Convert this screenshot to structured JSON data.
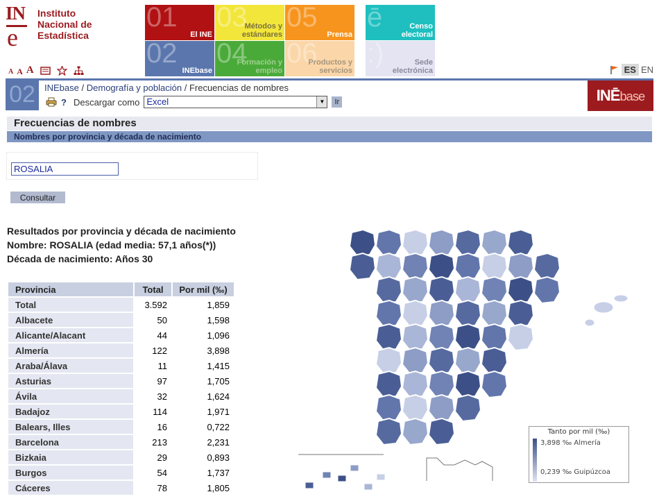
{
  "header": {
    "logo_lines": [
      "Instituto",
      "Nacional de",
      "Estadística"
    ],
    "tiles": [
      {
        "num": "01",
        "label": "El INE"
      },
      {
        "num": "03",
        "label": "Métodos y estándares"
      },
      {
        "num": "05",
        "label": "Prensa"
      },
      {
        "num": "ē",
        "label": "Censo electoral"
      },
      {
        "num": "02",
        "label": "INEbase"
      },
      {
        "num": "04",
        "label": "Formación y empleo"
      },
      {
        "num": "06",
        "label": "Productos y servicios"
      },
      {
        "num": ":)",
        "label": "Sede electrónica"
      }
    ],
    "font_sizes": [
      "A",
      "A",
      "A"
    ],
    "lang": {
      "active": "ES",
      "other": "EN"
    }
  },
  "breadcrumb": {
    "badge": "02",
    "items": [
      "INEbase",
      "Demografía y población",
      "Frecuencias de nombres"
    ],
    "separator": "/",
    "help": "?",
    "download_label": "Descargar como",
    "download_value": "Excel",
    "go_label": "Ir",
    "inebase_brand_a": "INĒ",
    "inebase_brand_b": "base"
  },
  "page": {
    "title": "Frecuencias de nombres",
    "subtitle": "Nombres por provincia y década de nacimiento",
    "search_value": "ROSALIA",
    "consultar_label": "Consultar",
    "results_heading": "Resultados por provincia y década de nacimiento",
    "results_name": "Nombre: ROSALIA (edad media: 57,1 años(*))",
    "results_decade": "Década de nacimiento: Años 30"
  },
  "table": {
    "headers": [
      "Provincia",
      "Total",
      "Por mil (‰)"
    ],
    "rows": [
      [
        "Total",
        "3.592",
        "1,859"
      ],
      [
        "Albacete",
        "50",
        "1,598"
      ],
      [
        "Alicante/Alacant",
        "44",
        "1,096"
      ],
      [
        "Almería",
        "122",
        "3,898"
      ],
      [
        "Araba/Álava",
        "11",
        "1,415"
      ],
      [
        "Asturias",
        "97",
        "1,705"
      ],
      [
        "Ávila",
        "32",
        "1,624"
      ],
      [
        "Badajoz",
        "114",
        "1,971"
      ],
      [
        "Balears, Illes",
        "16",
        "0,722"
      ],
      [
        "Barcelona",
        "213",
        "2,231"
      ],
      [
        "Bizkaia",
        "29",
        "0,893"
      ],
      [
        "Burgos",
        "54",
        "1,737"
      ],
      [
        "Cáceres",
        "78",
        "1,805"
      ]
    ]
  },
  "legend": {
    "title": "Tanto por mil (‰)",
    "max": "3,898 ‰ Almería",
    "min": "0,239 ‰ Guipúzcoa"
  },
  "colors": {
    "ine_red": "#9b1b1f",
    "inebase_blue": "#5a76ad",
    "map_dark": "#3c5087",
    "map_light": "#dde3f0"
  }
}
